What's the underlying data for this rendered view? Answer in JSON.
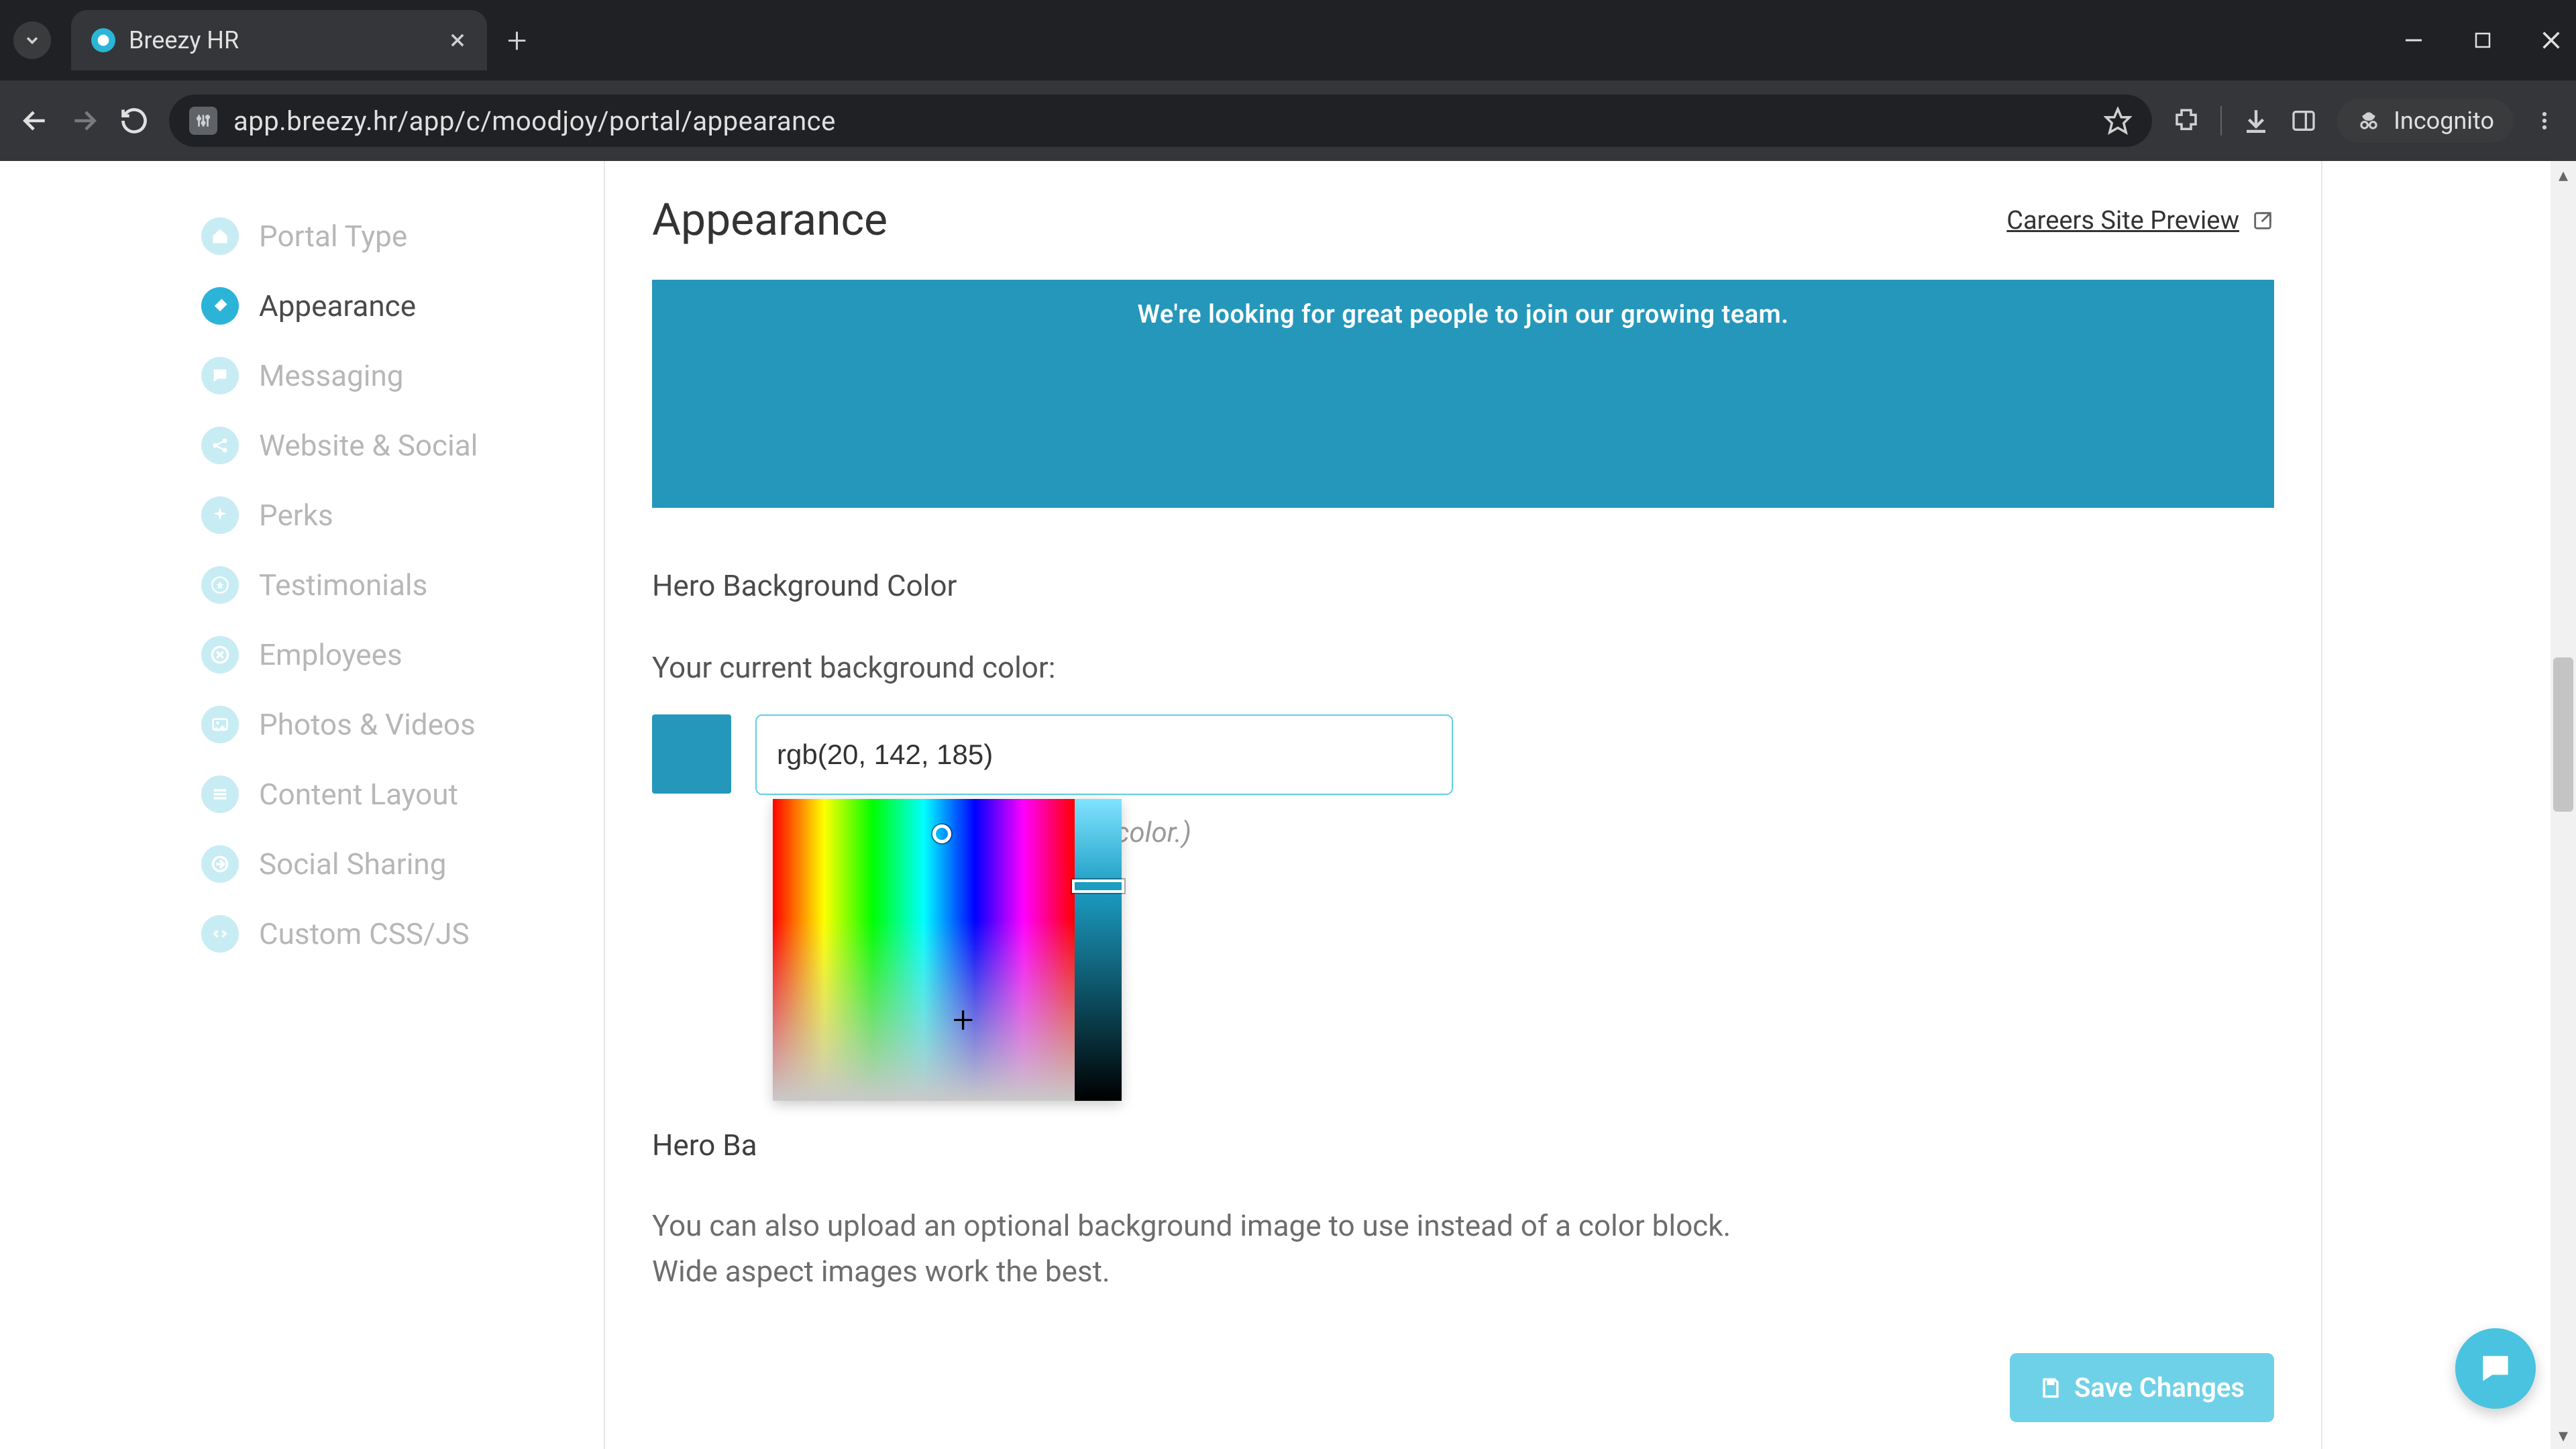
{
  "browser": {
    "tab_title": "Breezy HR",
    "url": "app.breezy.hr/app/c/moodjoy/portal/appearance",
    "incognito_label": "Incognito"
  },
  "sidebar": {
    "items": [
      {
        "label": "Portal Type",
        "icon": "home-icon"
      },
      {
        "label": "Appearance",
        "icon": "brush-icon"
      },
      {
        "label": "Messaging",
        "icon": "chat-icon"
      },
      {
        "label": "Website & Social",
        "icon": "share-icon"
      },
      {
        "label": "Perks",
        "icon": "sparkle-icon"
      },
      {
        "label": "Testimonials",
        "icon": "star-circle-icon"
      },
      {
        "label": "Employees",
        "icon": "close-circle-icon"
      },
      {
        "label": "Photos & Videos",
        "icon": "image-icon"
      },
      {
        "label": "Content Layout",
        "icon": "layout-icon"
      },
      {
        "label": "Social Sharing",
        "icon": "arrow-out-icon"
      },
      {
        "label": "Custom CSS/JS",
        "icon": "code-icon"
      }
    ],
    "active_index": 1
  },
  "main": {
    "title": "Appearance",
    "preview_link": "Careers Site Preview",
    "banner_text": "We're looking for great people to join our growing team.",
    "hero_section_label": "Hero Background Color",
    "current_color_label": "Your current background color:",
    "color_value": "rgb(20, 142, 185)",
    "hint_text": "color.)",
    "hero_image_label": "Hero Ba",
    "hero_image_desc_1": "You can also upload an optional background image to use instead of a color block.",
    "hero_image_desc_2": "Wide aspect images work the best.",
    "save_label": "Save Changes"
  },
  "colors": {
    "accent": "#2cb4d8",
    "banner": "#2597bb"
  }
}
